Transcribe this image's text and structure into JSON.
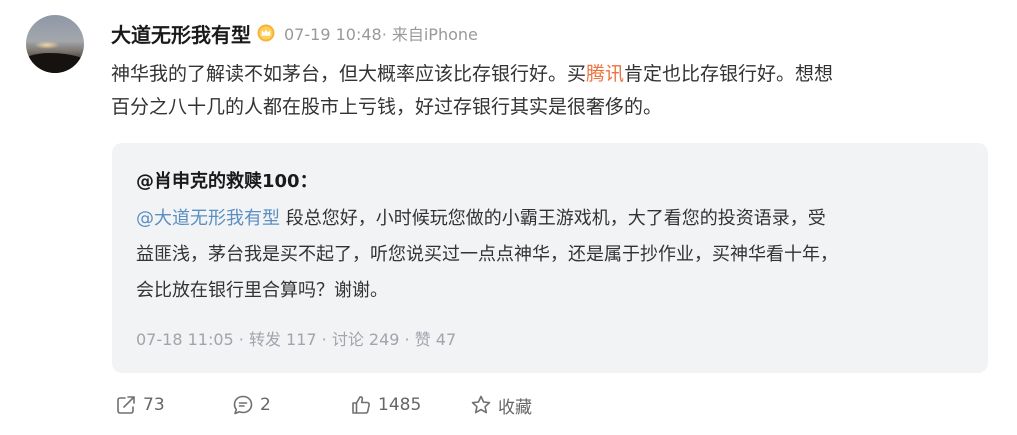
{
  "post": {
    "username": "大道无形我有型",
    "badge_icon": "vip-crown-icon",
    "meta": "07-19 10:48· 来自iPhone",
    "content": {
      "line1_before": "神华我的了解读不如茅台，但大概率应该比存银行好。买",
      "topic": "腾讯",
      "line1_after": "肯定也比存银行好。想想",
      "line2": "百分之八十几的人都在股市上亏钱，好过存银行其实是很奢侈的。"
    }
  },
  "quote": {
    "author": "@肖申克的救赎100：",
    "mention": "@大道无形我有型",
    "line1_rest": " 段总您好，小时候玩您做的小霸王游戏机，大了看您的投资语录，受",
    "line2": "益匪浅，茅台我是买不起了，听您说买过一点点神华，还是属于抄作业，买神华看十年，",
    "line3": "会比放在银行里合算吗？谢谢。",
    "footer": "07-18 11:05  · 转发 117 · 讨论 249 · 赞 47"
  },
  "actions": {
    "share_count": "73",
    "comment_count": "2",
    "like_count": "1485",
    "favorite_label": "收藏"
  },
  "colors": {
    "topic": "#eb7340",
    "mention": "#5a8fc2",
    "quote_bg": "#f2f3f5"
  }
}
